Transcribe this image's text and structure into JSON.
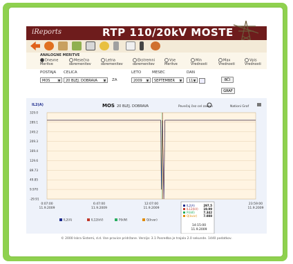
{
  "app": {
    "brand": "iReports",
    "title": "RTP 110/20kV MOSTE"
  },
  "toolbar": {
    "icons": [
      "back-arrow-icon",
      "balloon-icon",
      "edit-icon",
      "pen-icon",
      "chart-icon",
      "sun-icon",
      "battery-icon",
      "note-icon",
      "folder-icon",
      "rotate-icon"
    ]
  },
  "options": {
    "title": "ANALOGNE MERITVE",
    "items": [
      {
        "line1": "Dnevne",
        "line2": "Meritve",
        "selected": true
      },
      {
        "line1": "Mesečna",
        "line2": "obremenitev",
        "selected": false
      },
      {
        "line1": "Letna",
        "line2": "obremenitev",
        "selected": false
      },
      {
        "line1": "Ekstremni",
        "line2": "obremenitev",
        "selected": false
      },
      {
        "line1": "Vse",
        "line2": "Meritve",
        "selected": false
      },
      {
        "line1": "Min",
        "line2": "Vrednosti",
        "selected": false
      },
      {
        "line1": "Max",
        "line2": "Vrednosti",
        "selected": false
      },
      {
        "line1": "Vpis",
        "line2": "Vrednosti",
        "selected": false
      }
    ]
  },
  "controls": {
    "postaja_label": "POSTAJA",
    "celica_label": "CELICA",
    "leto_label": "LETO",
    "mesec_label": "MESEC",
    "dan_label": "DAN",
    "postaja_value": "MOS",
    "celica_value": "20 BLEJ. DOBRAVA",
    "za_label": "ZA",
    "leto_value": "2009",
    "mesec_value": "SEPTEMBER",
    "dan_value": "11",
    "bci_button": "BČI",
    "graf_button": "GRAF"
  },
  "chart_header": {
    "station": "MOS",
    "cell": "20 BLEJ. DOBRAVA",
    "zoom_text": "Povečaj čez cel zaslon",
    "nations_text": "Nationi Graf"
  },
  "chart_data": {
    "type": "line",
    "ylabel": "IL2(A)",
    "y_ticks": [
      "329.0",
      "289.1",
      "249.2",
      "209.3",
      "169.4",
      "129.6",
      "89.73",
      "49.85",
      "9.970",
      "-29.91"
    ],
    "ylim": [
      -29.91,
      329.0
    ],
    "x_ticks": [
      {
        "time": "0:07:00",
        "date": "11.9.2009"
      },
      {
        "time": "6:47:00",
        "date": "11.9.2009"
      },
      {
        "time": "12:07:00",
        "date": "11.9.2009"
      },
      {
        "time": "17:23:00",
        "date": "11.9.2009"
      },
      {
        "time": "23:59:00",
        "date": "11.9.2009"
      }
    ],
    "series": [
      {
        "name": "IL2(A)",
        "color": "#1c2a8c"
      },
      {
        "name": "IL12(kV)",
        "color": "#c0392b"
      },
      {
        "name": "P(kW)",
        "color": "#27ae60"
      },
      {
        "name": "Q(kvar)",
        "color": "#e08a00"
      }
    ],
    "line_points": [
      {
        "x": 0.0,
        "y": 297.5
      },
      {
        "x": 0.545,
        "y": 297.5
      },
      {
        "x": 0.548,
        "y": 9.97
      },
      {
        "x": 0.553,
        "y": 297.5
      },
      {
        "x": 0.56,
        "y": -29.91
      },
      {
        "x": 0.565,
        "y": 297.5
      },
      {
        "x": 1.0,
        "y": 297.5
      }
    ],
    "tooltip": {
      "rows": [
        {
          "label": "IL2(A)",
          "value": "297.5",
          "color": "#1c2a8c"
        },
        {
          "label": "IL12(kV)",
          "value": "19.99",
          "color": "#c0392b"
        },
        {
          "label": "P(kW)",
          "value": "7.342",
          "color": "#27ae60"
        },
        {
          "label": "Q(kvar)",
          "value": "7.088",
          "color": "#e08a00"
        }
      ],
      "time": "14:15:00",
      "date": "11.9.2009"
    }
  },
  "footer": "© 2000 Iskra Sistemi, d.d. Vse pravice pridržane. Verzija: 3.1 Posredba je trajala 2.0 sekunde. 1440 podatkov."
}
